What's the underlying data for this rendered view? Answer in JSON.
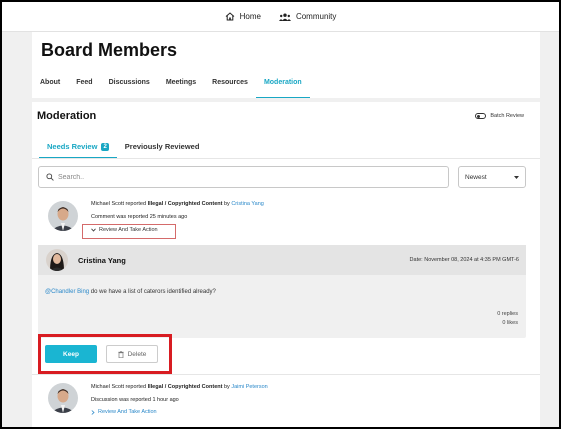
{
  "topnav": {
    "home_label": "Home",
    "community_label": "Community"
  },
  "header": {
    "title": "Board Members",
    "tabs": [
      {
        "label": "About"
      },
      {
        "label": "Feed"
      },
      {
        "label": "Discussions"
      },
      {
        "label": "Meetings"
      },
      {
        "label": "Resources"
      },
      {
        "label": "Moderation"
      }
    ],
    "active_tab": "Moderation"
  },
  "moderation": {
    "title": "Moderation",
    "batch_review_label": "Batch Review",
    "subtabs": [
      {
        "label": "Needs Review",
        "count": "2"
      },
      {
        "label": "Previously Reviewed"
      }
    ],
    "search_placeholder": "Search..",
    "sort_value": "Newest"
  },
  "reports": [
    {
      "reporter": "Michael Scott",
      "reported_text": "reported",
      "type": "Illegal / Copyrighted Content",
      "by_text": "by",
      "author": "Cristina Yang",
      "status": "Comment was reported 25 minutes ago",
      "action_label": "Review And Take Action"
    },
    {
      "reporter": "Michael Scott",
      "reported_text": "reported",
      "type": "Illegal / Copyrighted Content",
      "by_text": "by",
      "author": "Jaimi Peterson",
      "status": "Discussion was reported 1 hour ago",
      "action_label": "Review And Take Action"
    }
  ],
  "comment": {
    "author": "Cristina Yang",
    "date": "Date: November 08, 2024 at 4:35 PM GMT-6",
    "mention": "@Chandler Bing",
    "text": " do we have a list of caterors identified already?",
    "replies": "0 replies",
    "likes": "0 likes"
  },
  "actions": {
    "keep_label": "Keep",
    "delete_label": "Delete"
  },
  "colors": {
    "accent": "#1ab5d2",
    "link": "#2a88c9",
    "highlight_red": "#d81c22"
  }
}
